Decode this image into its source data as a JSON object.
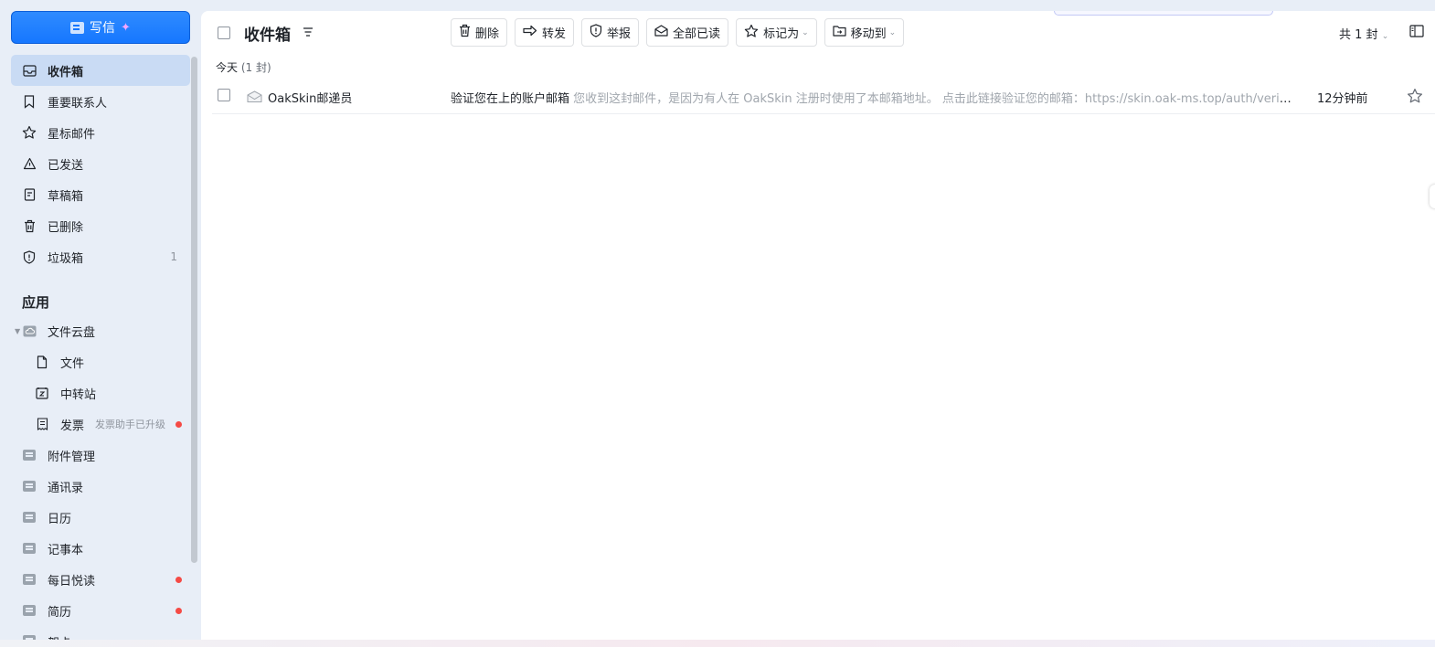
{
  "compose": {
    "label": "写信"
  },
  "nav": {
    "items": [
      {
        "label": "收件箱",
        "icon": "inbox-icon",
        "active": true
      },
      {
        "label": "重要联系人",
        "icon": "bookmark-icon"
      },
      {
        "label": "星标邮件",
        "icon": "star-icon"
      },
      {
        "label": "已发送",
        "icon": "send-icon"
      },
      {
        "label": "草稿箱",
        "icon": "draft-icon"
      },
      {
        "label": "已删除",
        "icon": "trash-icon"
      },
      {
        "label": "垃圾箱",
        "icon": "shield-icon",
        "count": "1"
      }
    ]
  },
  "apps": {
    "title": "应用",
    "cloud": {
      "label": "文件云盘"
    },
    "files": {
      "label": "文件"
    },
    "transfer": {
      "label": "中转站"
    },
    "invoice": {
      "label": "发票",
      "note": "发票助手已升级"
    },
    "attachments": {
      "label": "附件管理"
    },
    "contacts": {
      "label": "通讯录"
    },
    "calendar": {
      "label": "日历"
    },
    "notes": {
      "label": "记事本"
    },
    "daily": {
      "label": "每日悦读"
    },
    "resume": {
      "label": "简历"
    },
    "cards": {
      "label": "贺卡"
    }
  },
  "header": {
    "title": "收件箱"
  },
  "toolbar": {
    "delete": "删除",
    "forward": "转发",
    "report": "举报",
    "mark_all_read": "全部已读",
    "mark_as": "标记为",
    "move_to": "移动到"
  },
  "list": {
    "total": "共 1 封",
    "group": {
      "label": "今天",
      "count": "(1 封)"
    },
    "rows": [
      {
        "sender": "OakSkin邮递员",
        "subject": "验证您在上的账户邮箱",
        "preview": "您收到这封邮件，是因为有人在 OakSkin 注册时使用了本邮箱地址。 点击此链接验证您的邮箱：https://skin.oak-ms.top/auth/verify?token=",
        "time": "12分钟前"
      }
    ]
  },
  "colors": {
    "accent": "#1677ff",
    "active_bg": "#c9dbf4",
    "badge": "#f54a45"
  }
}
